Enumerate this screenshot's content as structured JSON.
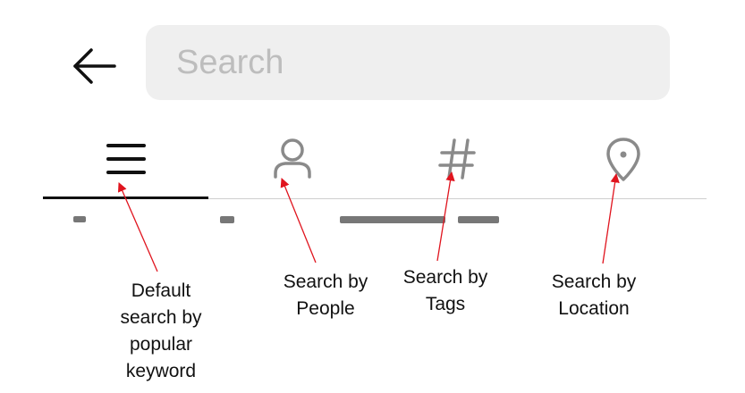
{
  "header": {
    "back_icon": "arrow-left-icon",
    "search": {
      "placeholder": "Search",
      "value": ""
    }
  },
  "tabs": [
    {
      "icon": "menu-icon",
      "active": true
    },
    {
      "icon": "person-icon",
      "active": false
    },
    {
      "icon": "hashtag-icon",
      "active": false
    },
    {
      "icon": "location-pin-icon",
      "active": false
    }
  ],
  "annotations": {
    "color": "#e0141e",
    "items": [
      {
        "text": "Default\nsearch by\npopular\nkeyword"
      },
      {
        "text": "Search by\nPeople"
      },
      {
        "text": "Search by\nTags"
      },
      {
        "text": "Search by\nLocation"
      }
    ]
  },
  "colors": {
    "active_icon": "#111111",
    "inactive_icon": "#8a8a8a",
    "search_bg": "#efefef",
    "placeholder": "#bdbdbd"
  }
}
